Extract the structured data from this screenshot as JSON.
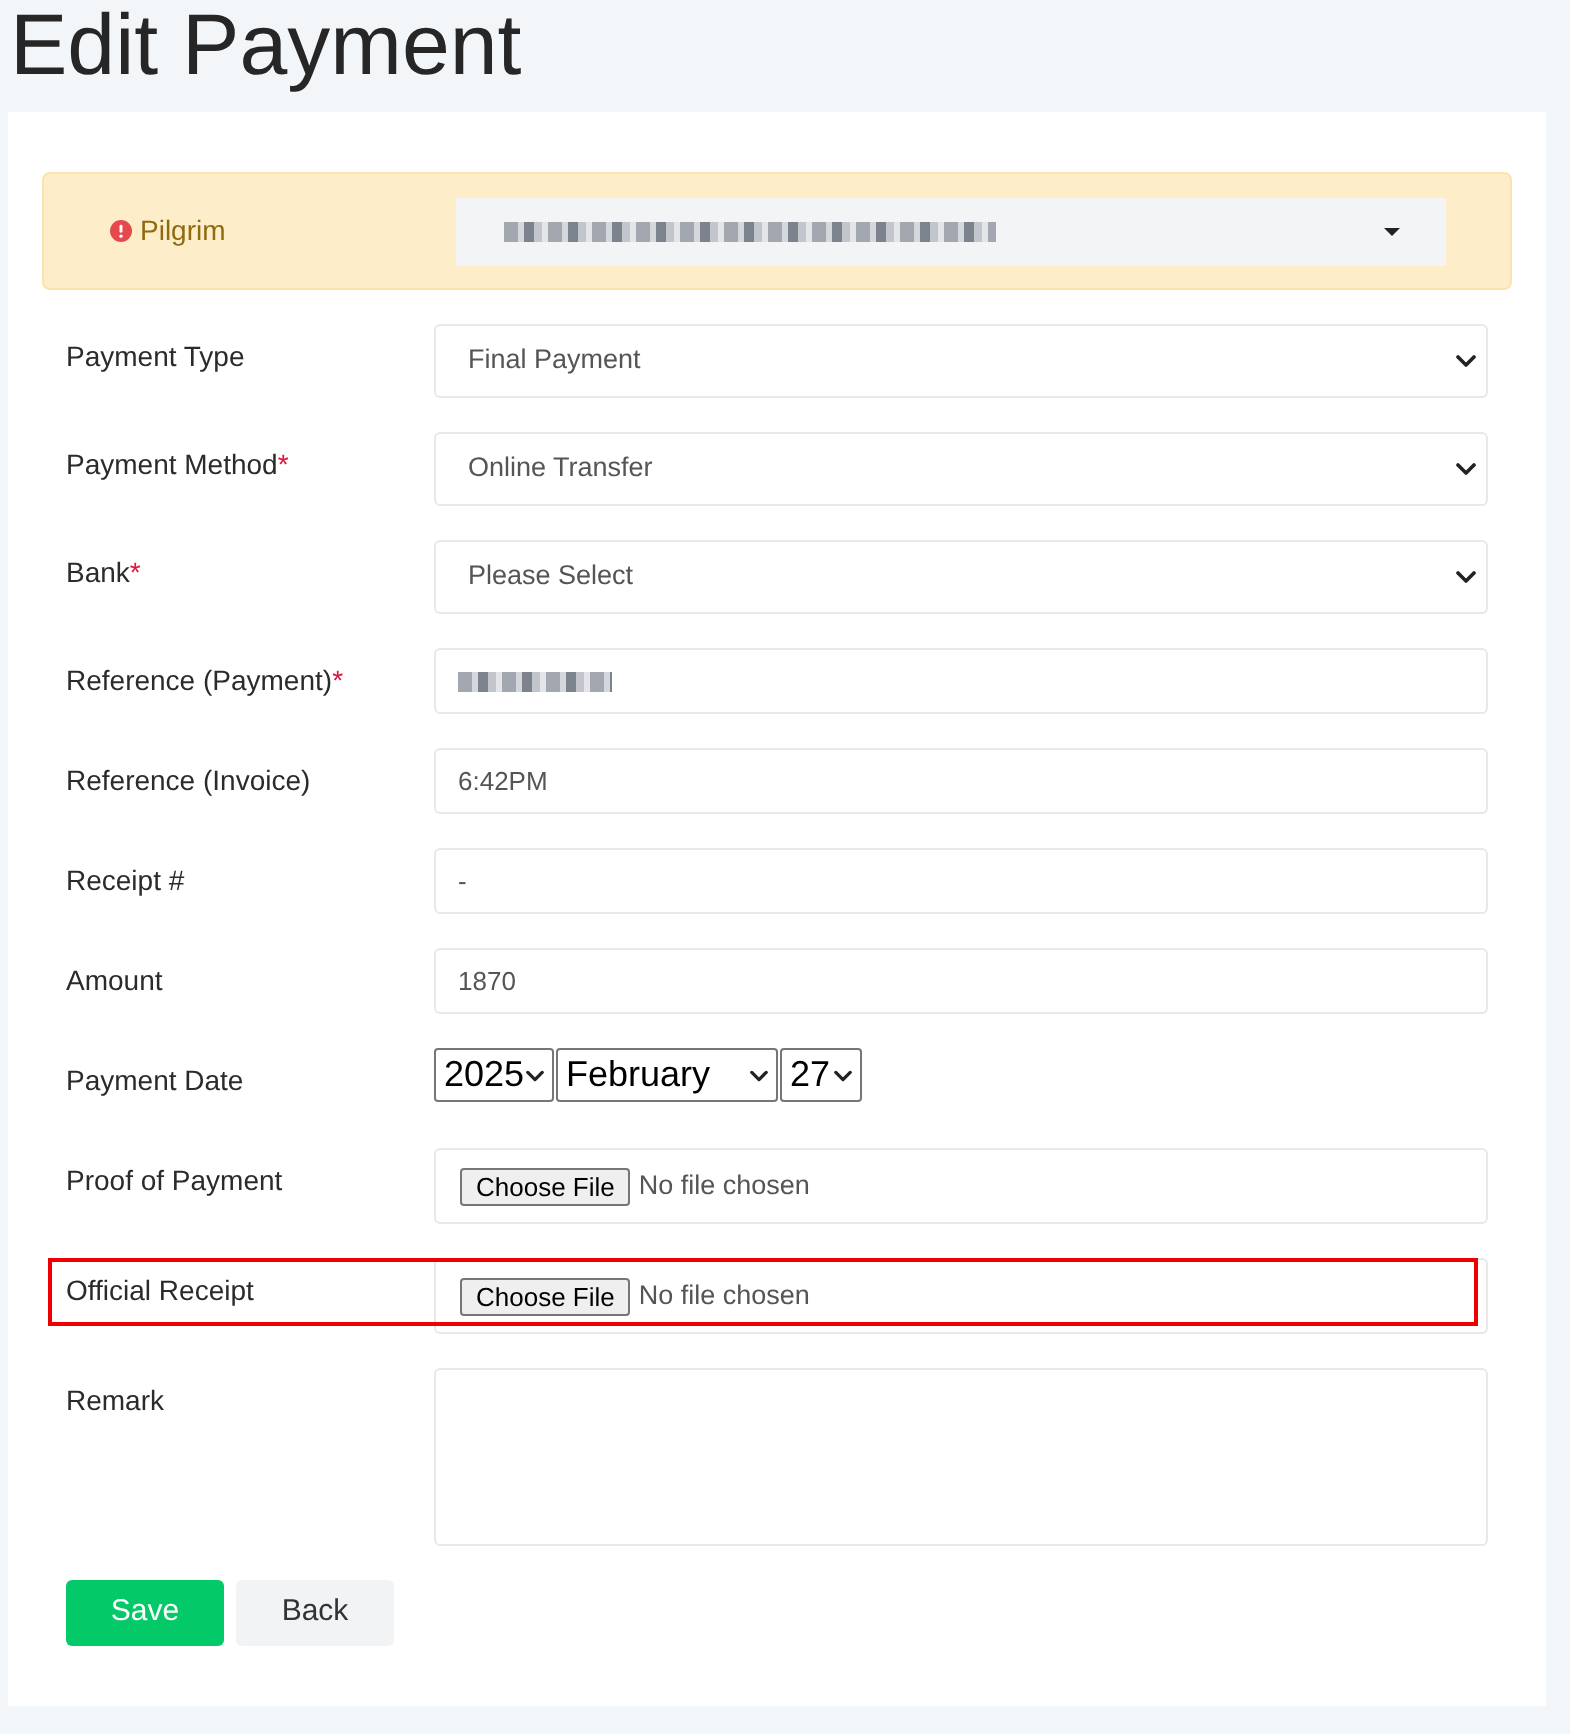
{
  "page": {
    "title": "Edit Payment"
  },
  "pilgrim": {
    "label": "Pilgrim",
    "redacted": true
  },
  "fields": [
    {
      "kind": "select",
      "label": "Payment Type",
      "value": "Final Payment",
      "highlighted": false
    },
    {
      "kind": "select",
      "label": "Payment Method",
      "required_mark": "*",
      "value": "Online Transfer",
      "highlighted": false
    },
    {
      "kind": "select",
      "label": "Bank",
      "required_mark": "*",
      "value": "Please Select",
      "highlighted": false
    },
    {
      "kind": "input",
      "label": "Reference (Payment)",
      "required_mark": "*",
      "redacted": true,
      "highlighted": false
    },
    {
      "kind": "input",
      "label": "Reference (Invoice)",
      "value": "6:42PM",
      "highlighted": false
    },
    {
      "kind": "input",
      "label": "Receipt #",
      "value": "-",
      "highlighted": false
    },
    {
      "kind": "input",
      "label": "Amount",
      "value": "1870",
      "highlighted": false
    },
    {
      "kind": "date",
      "label": "Payment Date",
      "parts": [
        "2025",
        "February",
        "27"
      ],
      "highlighted": false
    },
    {
      "kind": "file",
      "label": "Proof of Payment",
      "button": "Choose File",
      "status": "No file chosen",
      "highlighted": false
    },
    {
      "kind": "file",
      "label": "Official Receipt",
      "button": "Choose File",
      "status": "No file chosen",
      "highlighted": true
    },
    {
      "kind": "textarea",
      "label": "Remark",
      "highlighted": false
    }
  ],
  "buttons": [
    {
      "kind": "primary",
      "label": "Save"
    },
    {
      "kind": "secondary",
      "label": "Back"
    }
  ]
}
